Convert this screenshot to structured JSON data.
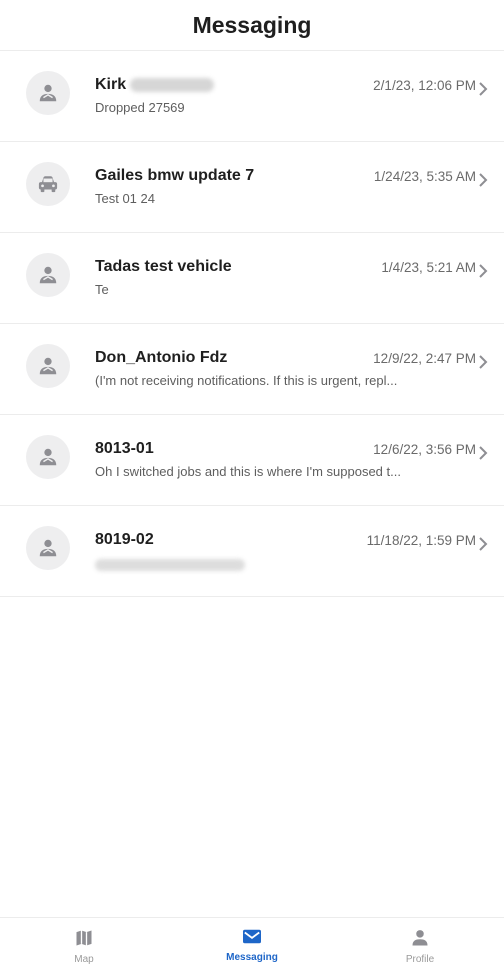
{
  "header": {
    "title": "Messaging"
  },
  "messages": [
    {
      "name": "Kirk",
      "name_redacted": true,
      "time": "2/1/23, 12:06 PM",
      "preview": "Dropped 27569",
      "icon": "person-icon"
    },
    {
      "name": "Gailes bmw update 7",
      "time": "1/24/23, 5:35 AM",
      "preview": "Test 01 24",
      "icon": "car-icon"
    },
    {
      "name": "Tadas test vehicle",
      "time": "1/4/23, 5:21 AM",
      "preview": "Te",
      "icon": "person-icon"
    },
    {
      "name": "Don_Antonio Fdz",
      "time": "12/9/22, 2:47 PM",
      "preview": "(I'm not receiving notifications. If this is urgent, repl...",
      "icon": "person-icon"
    },
    {
      "name": "8013-01",
      "time": "12/6/22, 3:56 PM",
      "preview": "Oh I switched jobs and this is where I'm supposed t...",
      "icon": "person-icon"
    },
    {
      "name": "8019-02",
      "time": "11/18/22, 1:59 PM",
      "preview_redacted": true,
      "icon": "person-icon"
    }
  ],
  "tabbar": {
    "tabs": [
      {
        "label": "Map",
        "icon": "map-icon",
        "active": false
      },
      {
        "label": "Messaging",
        "icon": "envelope-icon",
        "active": true
      },
      {
        "label": "Profile",
        "icon": "person-icon",
        "active": false
      }
    ],
    "accent_color": "#1e66c8"
  }
}
